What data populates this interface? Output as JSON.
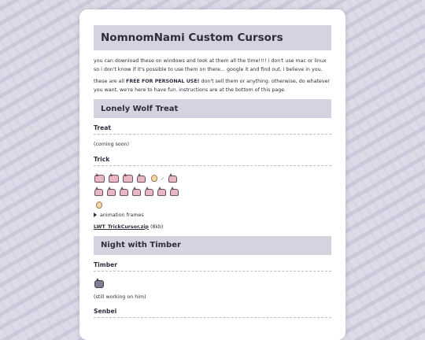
{
  "page": {
    "title": "NomnomNami Custom Cursors",
    "intro1": "you can download these on windows and look at them all the time!!!! i don't use mac or linux so i don't know if it's possible to use them on there... google it and find out. i believe in you.",
    "intro2_prefix": "these are all ",
    "intro2_bold": "FREE FOR PERSONAL USE!",
    "intro2_suffix": " don't sell them or anything. otherwise, do whatever you want, we're here to have fun. instructions are at the bottom of this page."
  },
  "sections": [
    {
      "title": "Lonely Wolf Treat",
      "subsections": [
        {
          "title": "Treat",
          "note": "(coming soon)"
        },
        {
          "title": "Trick",
          "details_label": "animation frames",
          "download_link": "LWT_TrickCursor.zip",
          "download_size": "(8kb)"
        }
      ]
    },
    {
      "title": "Night with Timber",
      "subsections": [
        {
          "title": "Timber",
          "note": "(still working on him)"
        },
        {
          "title": "Senbei"
        }
      ]
    }
  ],
  "icons": {
    "cursor": "cat-cursor-icon",
    "egg": "egg-cursor-icon",
    "wolf": "wolf-cursor-icon",
    "details_toggle": "triangle-right-icon"
  },
  "colors": {
    "background": "#dcdbe6",
    "title_bar": "#d4d3e0",
    "card": "#ffffff",
    "text": "#2f2f3f"
  }
}
